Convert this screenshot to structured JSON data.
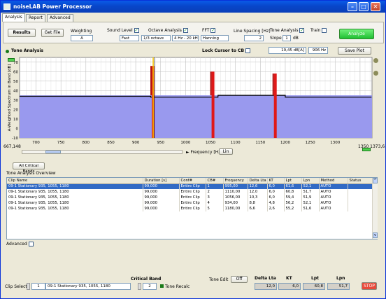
{
  "window": {
    "title": "noiseLAB Power Processor"
  },
  "tabs": [
    "Analysis",
    "Report",
    "Advanced"
  ],
  "toolbar": {
    "results_label": "Results",
    "get_file_label": "Get File",
    "weighting_label": "Weighting",
    "weighting_value": "A",
    "sound_level_label": "Sound Level",
    "sound_level_value": "Fast",
    "octave_label": "Octave Analysis",
    "octave_value": "1/3 octave",
    "octave_range": "4 Hz - 20 kHz",
    "fft_label": "FFT",
    "fft_value": "Hanning",
    "line_spacing_label": "Line Spacing [Hz]",
    "line_spacing_value": "2",
    "tone_label": "Tone Analysis",
    "slope_label": "Slope",
    "slope_value": "1",
    "slope_unit": "dB",
    "train_label": "Train",
    "analyze_label": "Analyze"
  },
  "chartpanel": {
    "title": "Tone Analysis",
    "lock_label": "Lock Cursor to CB",
    "readout_db": "19,45",
    "readout_db_unit": "dB[A]",
    "readout_hz": "906",
    "readout_hz_unit": "Hz",
    "save_label": "Save Plot",
    "freq_label": "Frequency [Hz]",
    "lin_label": "Lin",
    "x_left": "667,148",
    "x_right": "1350 1373,6"
  },
  "chart_data": {
    "type": "area",
    "ylabel": "A-Weighted Spectrum in Band [dB]",
    "yticks": [
      "70",
      "60",
      "50",
      "40",
      "30",
      "20",
      "10",
      "0",
      "-10"
    ],
    "ylim": [
      -10,
      75
    ],
    "xlim": [
      667,
      1374
    ],
    "xticks": [
      "700",
      "750",
      "800",
      "850",
      "900",
      "950",
      "1000",
      "1050",
      "1100",
      "1150",
      "1200",
      "1250",
      "1300",
      "1350"
    ],
    "base_level": 35,
    "black_line": [
      {
        "x": 667,
        "y": 34
      },
      {
        "x": 930,
        "y": 34
      },
      {
        "x": 930,
        "y": 33
      },
      {
        "x": 1065,
        "y": 33
      },
      {
        "x": 1065,
        "y": 35
      },
      {
        "x": 1200,
        "y": 35
      },
      {
        "x": 1200,
        "y": 33
      },
      {
        "x": 1373,
        "y": 33
      }
    ],
    "tones": [
      {
        "f": 935,
        "level": 66
      },
      {
        "f": 1055,
        "level": 60
      },
      {
        "f": 1180,
        "level": 58
      }
    ],
    "cursor": 935,
    "colors": {
      "fill": "#9999ee",
      "tone": "#e01818",
      "cursor": "#f2c200",
      "line": "#000000"
    }
  },
  "bands_button": "All Critical Bands",
  "overview": {
    "title": "Tone Analysis Overview",
    "headers": [
      "Clip Name",
      "Duration [s]",
      "Conf#",
      "CB#",
      "Frequency",
      "Delta Lta",
      "KT",
      "Lpt",
      "Lpn",
      "Method",
      "Status"
    ],
    "rows": [
      [
        "09-1 Stationary 935, 1055, 1180",
        "99,000",
        "Entire Clip",
        "1",
        "995,00",
        "12,6",
        "6,0",
        "61,6",
        "52,1",
        "AUTO",
        ""
      ],
      [
        "09-1 Stationary 935, 1055, 1180",
        "99,000",
        "Entire Clip",
        "2",
        "1110,00",
        "12,0",
        "6,0",
        "60,8",
        "51,7",
        "AUTO",
        ""
      ],
      [
        "09-1 Stationary 935, 1055, 1180",
        "99,000",
        "Entire Clip",
        "3",
        "1056,00",
        "10,3",
        "6,0",
        "59,4",
        "51,9",
        "AUTO",
        ""
      ],
      [
        "09-1 Stationary 935, 1055, 1180",
        "99,000",
        "Entire Clip",
        "4",
        "934,00",
        "8,8",
        "4,8",
        "56,2",
        "52,1",
        "AUTO",
        ""
      ],
      [
        "09-1 Stationary 935, 1055, 1180",
        "99,000",
        "Entire Clip",
        "5",
        "1180,00",
        "6,6",
        "2,6",
        "55,2",
        "51,6",
        "AUTO",
        ""
      ]
    ]
  },
  "advanced_label": "Advanced",
  "bottom": {
    "clip_select_label": "Clip Select",
    "clip_index": "1",
    "clip_name": "09-1 Stationary 935, 1055, 1180",
    "critical_band_label": "Critical Band",
    "critical_band_value": "2",
    "tone_recalc_label": "Tone Recalc",
    "tone_edit_label": "Tone Edit",
    "tone_edit_value": "Off",
    "delta_lta_label": "Delta Lta",
    "delta_lta_value": "12,0",
    "kt_label": "KT",
    "kt_value": "6,0",
    "lpt_label": "Lpt",
    "lpt_value": "60,8",
    "lpn_label": "Lpn",
    "lpn_value": "51,7",
    "stop_label": "STOP"
  }
}
